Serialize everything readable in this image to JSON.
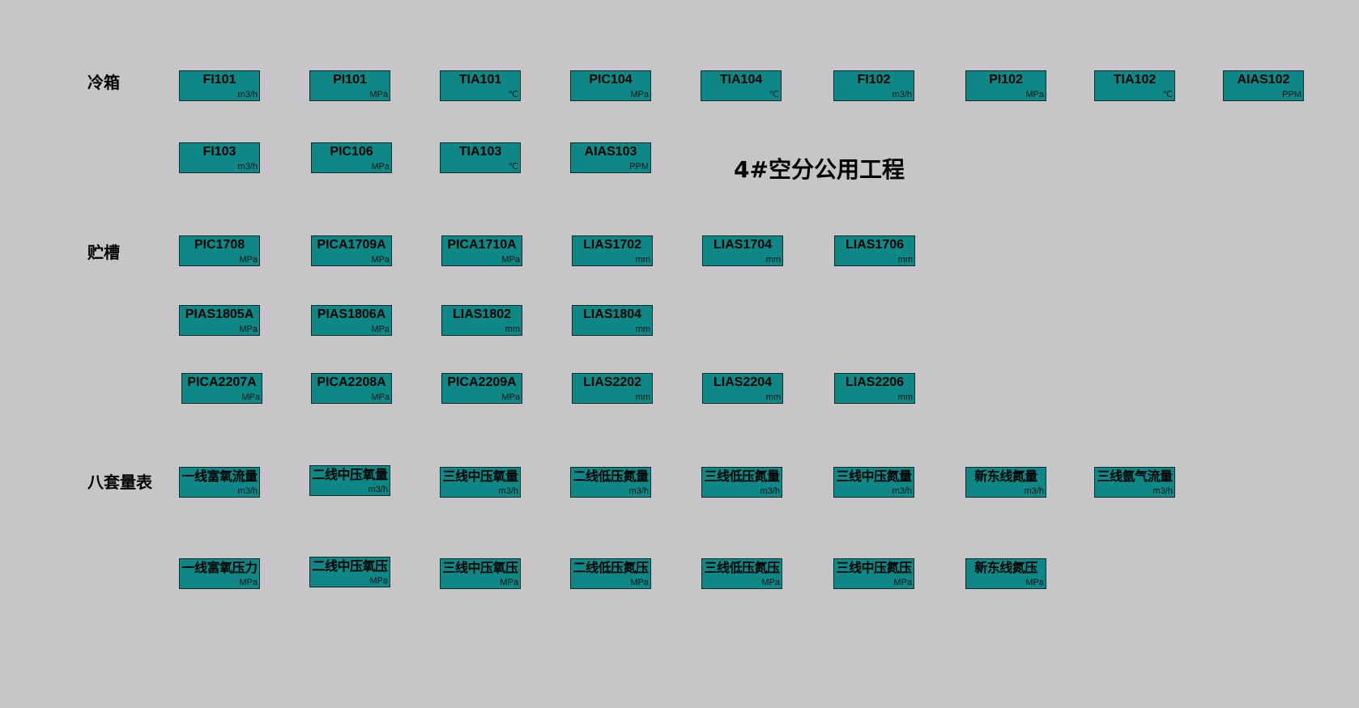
{
  "title": "4#空分公用工程",
  "sections": {
    "cold_box": "冷箱",
    "storage_tank": "贮槽",
    "eight_meters": "八套量表"
  },
  "tags": {
    "fi101": {
      "name": "FI101",
      "unit": "m3/h"
    },
    "pi101": {
      "name": "PI101",
      "unit": "MPa"
    },
    "tia101": {
      "name": "TIA101",
      "unit": "℃"
    },
    "pic104": {
      "name": "PIC104",
      "unit": "MPa"
    },
    "tia104": {
      "name": "TIA104",
      "unit": "℃"
    },
    "fi102": {
      "name": "FI102",
      "unit": "m3/h"
    },
    "pi102": {
      "name": "PI102",
      "unit": "MPa"
    },
    "tia102": {
      "name": "TIA102",
      "unit": "℃"
    },
    "aias102": {
      "name": "AIAS102",
      "unit": "PPM"
    },
    "fi103": {
      "name": "FI103",
      "unit": "m3/h"
    },
    "pic106": {
      "name": "PIC106",
      "unit": "MPa"
    },
    "tia103": {
      "name": "TIA103",
      "unit": "℃"
    },
    "aias103": {
      "name": "AIAS103",
      "unit": "PPM"
    },
    "pic1708": {
      "name": "PIC1708",
      "unit": "MPa"
    },
    "pica1709a": {
      "name": "PICA1709A",
      "unit": "MPa"
    },
    "pica1710a": {
      "name": "PICA1710A",
      "unit": "MPa"
    },
    "lias1702": {
      "name": "LIAS1702",
      "unit": "mm"
    },
    "lias1704": {
      "name": "LIAS1704",
      "unit": "mm"
    },
    "lias1706": {
      "name": "LIAS1706",
      "unit": "mm"
    },
    "pias1805a": {
      "name": "PIAS1805A",
      "unit": "MPa"
    },
    "pias1806a": {
      "name": "PIAS1806A",
      "unit": "MPa"
    },
    "lias1802": {
      "name": "LIAS1802",
      "unit": "mm"
    },
    "lias1804": {
      "name": "LIAS1804",
      "unit": "mm"
    },
    "pica2207a": {
      "name": "PICA2207A",
      "unit": "MPa"
    },
    "pica2208a": {
      "name": "PICA2208A",
      "unit": "MPa"
    },
    "pica2209a": {
      "name": "PICA2209A",
      "unit": "MPa"
    },
    "lias2202": {
      "name": "LIAS2202",
      "unit": "mm"
    },
    "lias2204": {
      "name": "LIAS2204",
      "unit": "mm"
    },
    "lias2206": {
      "name": "LIAS2206",
      "unit": "mm"
    },
    "flow_line1_rich_o2": {
      "name": "一线富氧流量",
      "unit": "m3/h"
    },
    "flow_line2_mp_o2": {
      "name": "二线中压氧量",
      "unit": "m3/h"
    },
    "flow_line3_mp_o2": {
      "name": "三线中压氧量",
      "unit": "m3/h"
    },
    "flow_line2_lp_n2": {
      "name": "二线低压氮量",
      "unit": "m3/h"
    },
    "flow_line3_lp_n2": {
      "name": "三线低压氮量",
      "unit": "m3/h"
    },
    "flow_line3_mp_n2": {
      "name": "三线中压氮量",
      "unit": "m3/h"
    },
    "flow_xindong_n2": {
      "name": "新东线氮量",
      "unit": "m3/h"
    },
    "flow_line3_ar": {
      "name": "三线氩气流量",
      "unit": "m3/h"
    },
    "press_line1_rich_o2": {
      "name": "一线富氧压力",
      "unit": "MPa"
    },
    "press_line2_mp_o2": {
      "name": "二线中压氧压",
      "unit": "MPa"
    },
    "press_line3_mp_o2": {
      "name": "三线中压氧压",
      "unit": "MPa"
    },
    "press_line2_lp_n2": {
      "name": "二线低压氮压",
      "unit": "MPa"
    },
    "press_line3_lp_n2": {
      "name": "三线低压氮压",
      "unit": "MPa"
    },
    "press_line3_mp_n2": {
      "name": "三线中压氮压",
      "unit": "MPa"
    },
    "press_xindong_n2": {
      "name": "新东线氮压",
      "unit": "MPa"
    }
  }
}
